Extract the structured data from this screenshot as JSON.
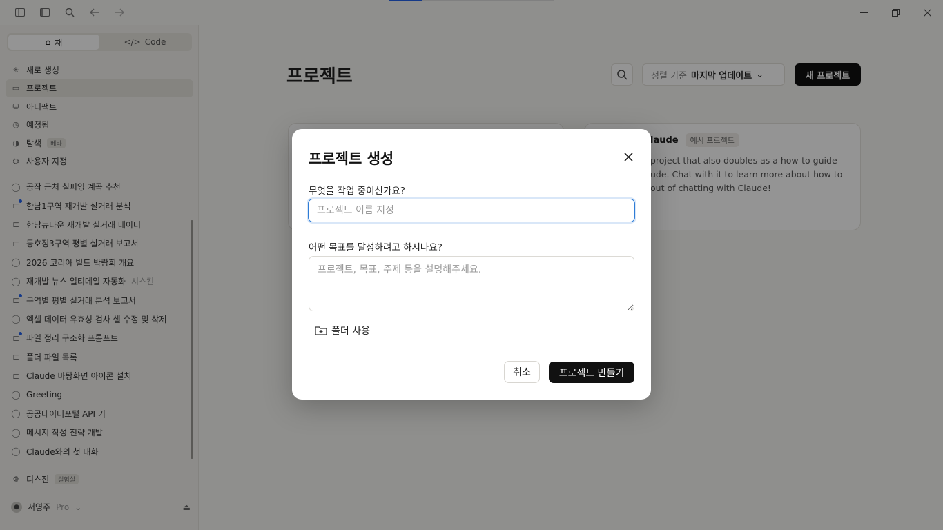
{
  "titlebar": {
    "icons": [
      "sidebar-toggle-icon",
      "panel-icon",
      "search-icon",
      "back-arrow-icon",
      "forward-arrow-icon"
    ],
    "progress": 0.2
  },
  "sidebar": {
    "mode_toggle": {
      "chat_label": "채",
      "code_label": "Code"
    },
    "nav": [
      {
        "label": "새로 생성",
        "icon": "plus-icon"
      },
      {
        "label": "프로젝트",
        "icon": "folder-icon",
        "active": true
      },
      {
        "label": "아티팩트",
        "icon": "artifacts-icon"
      },
      {
        "label": "예정됨",
        "icon": "clock-icon"
      },
      {
        "label": "탐색",
        "icon": "compass-icon",
        "badge": "베타"
      },
      {
        "label": "사용자 지정",
        "icon": "customize-icon"
      }
    ],
    "recents": [
      {
        "label": "공작 근처 칠피잉 계곡 추천",
        "unread": false,
        "icon": "chat-icon"
      },
      {
        "label": "한남1구역 재개발 실거래 분석",
        "unread": true,
        "icon": "code-icon"
      },
      {
        "label": "한남뉴타운 재개발 실거래 데이터",
        "unread": false,
        "icon": "code-icon"
      },
      {
        "label": "동호정3구역 평별 실거래 보고서",
        "unread": false,
        "icon": "code-icon"
      },
      {
        "label": "2026 코리아 빌드 박람회 개요",
        "unread": false,
        "icon": "chat-icon"
      },
      {
        "label": "재개발 뉴스 일티메일 자동화",
        "tail": "시스킨",
        "unread": false,
        "icon": "chat-icon"
      },
      {
        "label": "구역별 평별 실거래 분석 보고서",
        "unread": true,
        "icon": "code-icon"
      },
      {
        "label": "엑셀 데이터 유효성 검사 셀 수정 및 삭제",
        "unread": false,
        "icon": "chat-icon"
      },
      {
        "label": "파일 정리 구조화 프롬프트",
        "unread": true,
        "icon": "code-icon"
      },
      {
        "label": "폴더 파일 목록",
        "unread": false,
        "icon": "code-icon"
      },
      {
        "label": "Claude 바탕화면 아이콘 설치",
        "unread": false,
        "icon": "code-icon"
      },
      {
        "label": "Greeting",
        "unread": false,
        "icon": "chat-icon"
      },
      {
        "label": "공공데이터포털 API 키",
        "unread": false,
        "icon": "chat-icon"
      },
      {
        "label": "메시지 작성 전략 개발",
        "unread": false,
        "icon": "chat-icon"
      },
      {
        "label": "Claude와의 첫 대화",
        "unread": false,
        "icon": "chat-icon"
      }
    ],
    "bottom": {
      "dispatch_label": "디스전",
      "dispatch_badge": "실험실",
      "user_name": "서영주",
      "plan": "Pro"
    }
  },
  "main": {
    "title": "프로젝트",
    "sort_prefix": "정렬 기준",
    "sort_value": "마지막 업데이트",
    "new_project_label": "새 프로젝트",
    "card_2": {
      "title": "laude",
      "badge": "예시 프로젝트",
      "description": "project that also doubles as a how-to guide ude. Chat with it to learn more about how to out of chatting with Claude!"
    }
  },
  "modal": {
    "title": "프로젝트 생성",
    "name_label": "무엇을 작업 중이신가요?",
    "name_placeholder": "프로젝트 이름 지정",
    "name_value": "",
    "desc_label": "어떤 목표를 달성하려고 하시나요?",
    "desc_placeholder": "프로젝트, 목표, 주제 등을 설명해주세요.",
    "folder_label": "폴더 사용",
    "cancel_label": "취소",
    "create_label": "프로젝트 만들기"
  }
}
